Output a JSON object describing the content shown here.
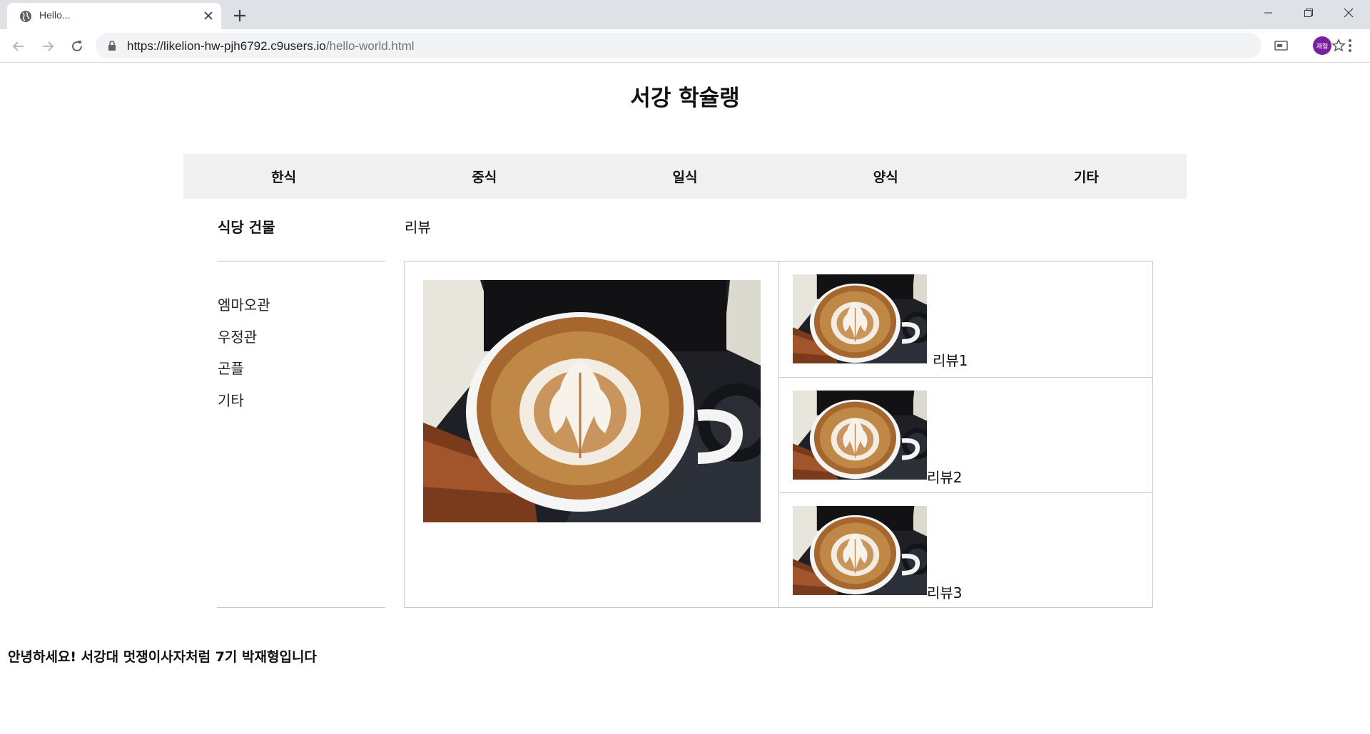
{
  "browser": {
    "tab_title": "Hello...",
    "url_host": "https://likelion-hw-pjh6792.c9users.io",
    "url_path": "/hello-world.html",
    "avatar_text": "재형",
    "avatar_color": "#7b1fa2"
  },
  "page": {
    "title": "서강 학슐랭",
    "categories": [
      "한식",
      "중식",
      "일식",
      "양식",
      "기타"
    ],
    "sidebar_heading": "식당 건물",
    "review_heading": "리뷰",
    "buildings": [
      "엠마오관",
      "우정관",
      "곤플",
      "기타"
    ],
    "reviews": [
      "리뷰1",
      "리뷰2",
      "리뷰3"
    ],
    "footer": "안녕하세요! 서강대 멋쟁이사자처럼 7기 박재형입니다"
  }
}
